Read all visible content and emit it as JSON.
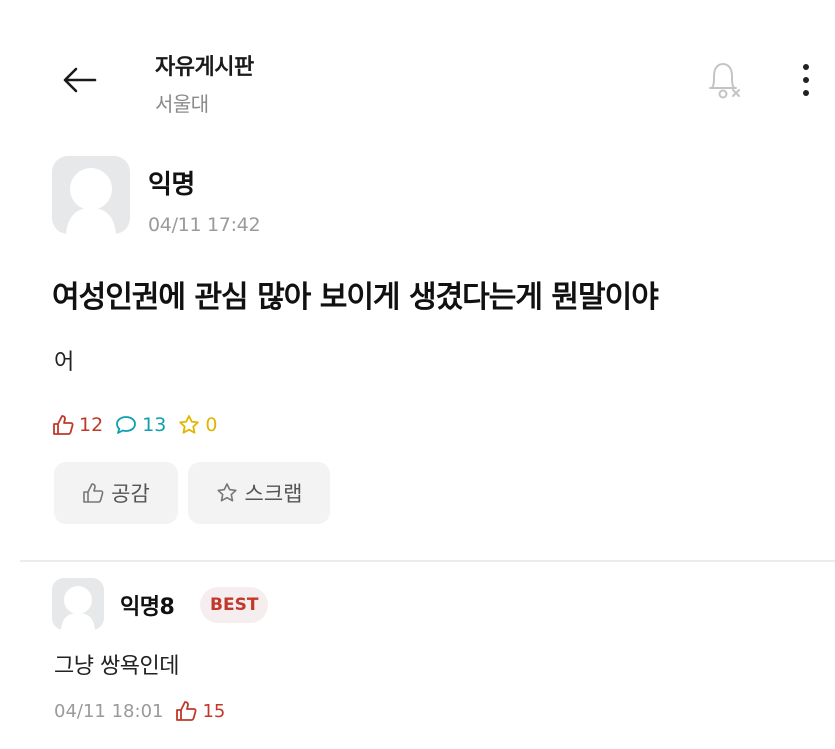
{
  "header": {
    "board_title": "자유게시판",
    "board_subtitle": "서울대",
    "icons": {
      "back": "arrow-left-icon",
      "bell": "bell-off-icon",
      "more": "more-vertical-icon"
    }
  },
  "post": {
    "author": "익명",
    "time": "04/11 17:42",
    "title": "여성인권에 관심 많아 보이게 생겼다는게 뭔말이야",
    "body": "어",
    "likes": "12",
    "comments": "13",
    "scraps": "0",
    "like_button_label": "공감",
    "scrap_button_label": "스크랩"
  },
  "comment": {
    "author": "익명8",
    "badge": "BEST",
    "body": "그냥 쌍욕인데",
    "time": "04/11 18:01",
    "likes": "15"
  },
  "colors": {
    "like": "#c0392b",
    "comment": "#0f9fb0",
    "scrap": "#e2b500",
    "muted": "#9a9a9a",
    "button_bg": "#f3f3f4"
  }
}
